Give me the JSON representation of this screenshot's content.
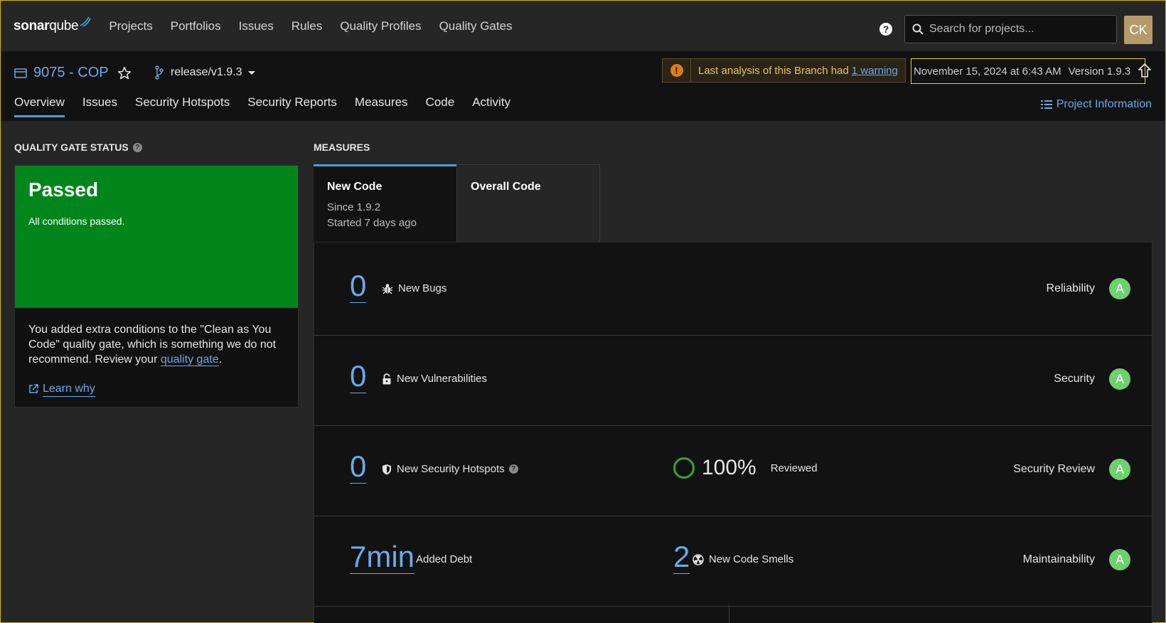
{
  "brand": {
    "name_a": "sonar",
    "name_b": "qube"
  },
  "topnav": {
    "items": [
      "Projects",
      "Portfolios",
      "Issues",
      "Rules",
      "Quality Profiles",
      "Quality Gates"
    ],
    "search_placeholder": "Search for projects...",
    "avatar_initials": "CK"
  },
  "project": {
    "name": "9075 - COP",
    "branch": "release/v1.9.3",
    "warning_text": "Last analysis of this Branch had",
    "warning_link": "1 warning",
    "analysis_date": "November 15, 2024 at 6:43 AM",
    "version": "Version 1.9.3",
    "tabs": [
      "Overview",
      "Issues",
      "Security Hotspots",
      "Security Reports",
      "Measures",
      "Code",
      "Activity"
    ],
    "active_tab": "Overview",
    "project_info": "Project Information"
  },
  "quality_gate": {
    "title": "QUALITY GATE STATUS",
    "status": "Passed",
    "subtitle": "All conditions passed.",
    "note_pre": "You added extra conditions to the \"Clean as You Code\" quality gate, which is something we do not recommend. Review your",
    "note_link": "quality gate",
    "note_post": ".",
    "learn_link": "Learn why",
    "color": "#00851b"
  },
  "measures": {
    "title": "MEASURES",
    "tab_new": {
      "title": "New Code",
      "since": "Since 1.9.2",
      "started": "Started 7 days ago"
    },
    "tab_overall": {
      "title": "Overall Code"
    },
    "rows": {
      "bugs": {
        "value": "0",
        "label": "New Bugs",
        "category": "Reliability",
        "grade": "A"
      },
      "vulns": {
        "value": "0",
        "label": "New Vulnerabilities",
        "category": "Security",
        "grade": "A"
      },
      "hotspots": {
        "value": "0",
        "label": "New Security Hotspots",
        "reviewed_pct": "100%",
        "reviewed_label": "Reviewed",
        "category": "Security Review",
        "grade": "A"
      },
      "debt": {
        "value": "7min",
        "label": "Added Debt",
        "smells_value": "2",
        "smells_label": "New Code Smells",
        "category": "Maintainability",
        "grade": "A"
      }
    },
    "grade_color": "#6dd16d"
  }
}
